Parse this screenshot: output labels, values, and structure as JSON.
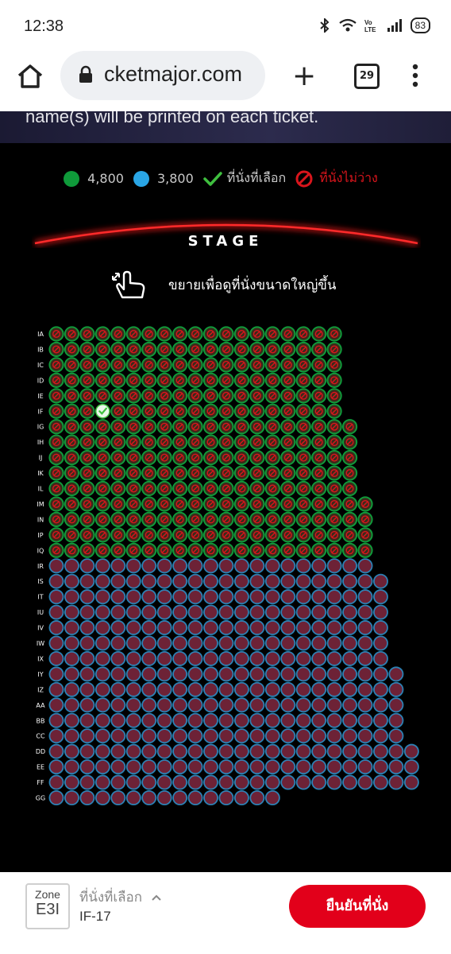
{
  "status_bar": {
    "time": "12:38",
    "battery": "83"
  },
  "browser": {
    "url": "cketmajor.com",
    "tab_count": "29"
  },
  "banner_text": "name(s) will be printed on each ticket.",
  "legend": {
    "green_price": "4,800",
    "blue_price": "3,800",
    "selected_label": "ที่นั่งที่เลือก",
    "unavailable_label": "ที่นั่งไม่ว่าง"
  },
  "colors": {
    "zone_green": "#0f9a3a",
    "zone_blue": "#2aa6e6",
    "unavailable": "#d9151c",
    "selected_check": "#3fbf3f",
    "confirm_button": "#e2001a"
  },
  "stage_label": "STAGE",
  "zoom_hint": "ขยายเพื่อดูที่นั่งขนาดใหญ่ขึ้น",
  "seat_map": {
    "rows": [
      {
        "label": "IA",
        "seats": 19,
        "zone": "green"
      },
      {
        "label": "IB",
        "seats": 19,
        "zone": "green"
      },
      {
        "label": "IC",
        "seats": 19,
        "zone": "green"
      },
      {
        "label": "ID",
        "seats": 19,
        "zone": "green"
      },
      {
        "label": "IE",
        "seats": 19,
        "zone": "green"
      },
      {
        "label": "IF",
        "seats": 19,
        "zone": "green",
        "selected_seat": 3
      },
      {
        "label": "IG",
        "seats": 20,
        "zone": "green"
      },
      {
        "label": "IH",
        "seats": 20,
        "zone": "green"
      },
      {
        "label": "IJ",
        "seats": 20,
        "zone": "green"
      },
      {
        "label": "IK",
        "seats": 20,
        "zone": "green"
      },
      {
        "label": "IL",
        "seats": 20,
        "zone": "green"
      },
      {
        "label": "IM",
        "seats": 21,
        "zone": "green"
      },
      {
        "label": "IN",
        "seats": 21,
        "zone": "green"
      },
      {
        "label": "IP",
        "seats": 21,
        "zone": "green"
      },
      {
        "label": "IQ",
        "seats": 21,
        "zone": "green"
      },
      {
        "label": "IR",
        "seats": 21,
        "zone": "blue"
      },
      {
        "label": "IS",
        "seats": 22,
        "zone": "blue"
      },
      {
        "label": "IT",
        "seats": 22,
        "zone": "blue"
      },
      {
        "label": "IU",
        "seats": 22,
        "zone": "blue"
      },
      {
        "label": "IV",
        "seats": 22,
        "zone": "blue"
      },
      {
        "label": "IW",
        "seats": 22,
        "zone": "blue"
      },
      {
        "label": "IX",
        "seats": 22,
        "zone": "blue"
      },
      {
        "label": "IY",
        "seats": 23,
        "zone": "blue"
      },
      {
        "label": "IZ",
        "seats": 23,
        "zone": "blue"
      },
      {
        "label": "AA",
        "seats": 23,
        "zone": "blue"
      },
      {
        "label": "BB",
        "seats": 23,
        "zone": "blue"
      },
      {
        "label": "CC",
        "seats": 23,
        "zone": "blue"
      },
      {
        "label": "DD",
        "seats": 24,
        "zone": "blue"
      },
      {
        "label": "EE",
        "seats": 24,
        "zone": "blue"
      },
      {
        "label": "FF",
        "seats": 24,
        "zone": "blue"
      },
      {
        "label": "GG",
        "seats": 15,
        "zone": "blue"
      }
    ]
  },
  "footer": {
    "zone_caption": "Zone",
    "zone_value": "E3I",
    "selected_caption": "ที่นั่งที่เลือก",
    "selected_value": "IF-17",
    "confirm_label": "ยืนยันที่นั่ง"
  }
}
